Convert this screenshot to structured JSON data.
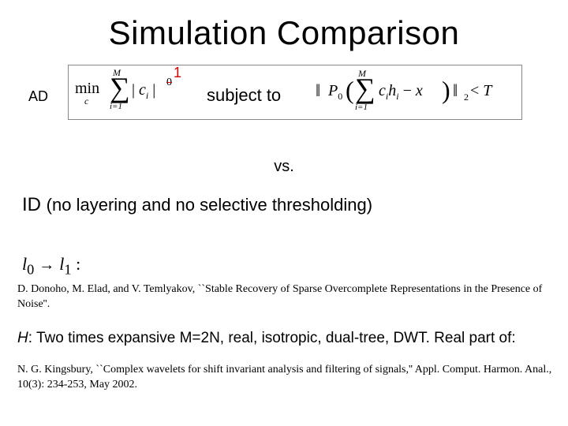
{
  "title": "Simulation Comparison",
  "ad_label": "AD",
  "formula1": {
    "min": "min",
    "min_sub": "c",
    "sigma_top": "M",
    "sigma_bottom": "i=1",
    "term": "| cᵢ |",
    "exp_struck": "0"
  },
  "one_overlay": "1",
  "subject_to": "subject to",
  "formula2": {
    "norm_open": "‖",
    "P0": "P",
    "P0_sub": "0",
    "paren_l": "(",
    "sigma_top": "M",
    "sigma_bottom": "i=1",
    "summand": "cᵢhᵢ − x",
    "paren_r": ")",
    "norm_close": "‖",
    "norm_sub": "2",
    "lt": "<",
    "T": "T"
  },
  "vs": "vs.",
  "id_line_prefix": "ID ",
  "id_line_rest": "(no layering and no selective thresholding)",
  "l0l1": {
    "l": "l",
    "zero": "0",
    "arrow": "→",
    "one": "1",
    "colon": " :"
  },
  "ref1": "D. Donoho, M. Elad, and V. Temlyakov, ``Stable Recovery of Sparse Overcomplete Representations in the Presence of Noise''.",
  "h_line_prefix": "H",
  "h_line_rest": ": Two times expansive M=2N, real, isotropic, dual-tree, DWT. Real part of:",
  "ref2": "N. G. Kingsbury, ``Complex wavelets for shift invariant analysis and filtering of signals,'' Appl. Comput. Harmon. Anal., 10(3): 234-253, May 2002."
}
